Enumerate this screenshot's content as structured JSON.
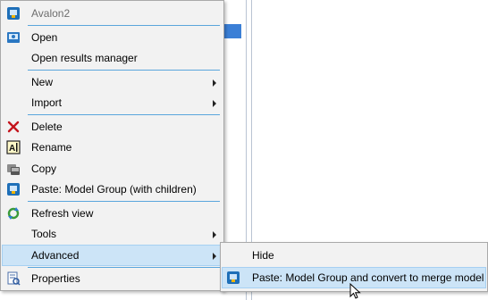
{
  "menu": {
    "title": "Avalon2",
    "items": [
      {
        "label": "Open",
        "icon": "model-icon"
      },
      {
        "label": "Open results manager"
      },
      {
        "label": "New",
        "submenu": true
      },
      {
        "label": "Import",
        "submenu": true
      },
      {
        "label": "Delete",
        "icon": "delete-icon"
      },
      {
        "label": "Rename",
        "icon": "rename-icon"
      },
      {
        "label": "Copy",
        "icon": "copy-icon"
      },
      {
        "label": "Paste: Model Group (with children)",
        "icon": "paste-model-icon"
      },
      {
        "label": "Refresh view",
        "icon": "refresh-icon"
      },
      {
        "label": "Tools",
        "submenu": true
      },
      {
        "label": "Advanced",
        "submenu": true
      },
      {
        "label": "Properties",
        "icon": "properties-icon"
      }
    ]
  },
  "submenu": {
    "items": [
      {
        "label": "Hide"
      },
      {
        "label": "Paste: Model Group and convert to merge model",
        "icon": "paste-model-icon"
      }
    ]
  },
  "colors": {
    "highlight": "#cce4f7",
    "separator": "#5aa6dc",
    "menu_bg": "#f2f2f2"
  }
}
